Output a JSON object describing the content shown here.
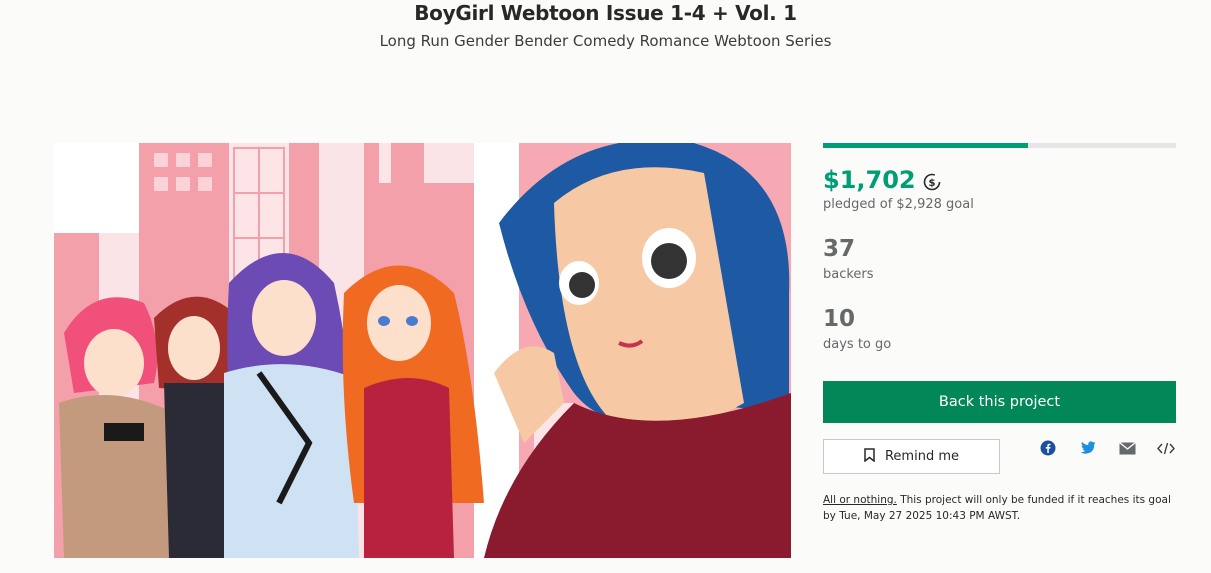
{
  "header": {
    "title": "BoyGirl Webtoon Issue 1-4 + Vol. 1",
    "subtitle": "Long Run Gender Bender Comedy Romance Webtoon Series"
  },
  "funding": {
    "progress_fraction": 0.581,
    "pledged": "$1,702",
    "pledged_sub": "pledged of $2,928 goal",
    "backers_count": "37",
    "backers_label": "backers",
    "days_count": "10",
    "days_label": "days to go"
  },
  "actions": {
    "back_label": "Back this project",
    "remind_label": "Remind me"
  },
  "share": [
    "facebook-icon",
    "twitter-icon",
    "email-icon",
    "embed-icon"
  ],
  "fine_print": {
    "link": "All or nothing.",
    "text": " This project will only be funded if it reaches its goal by Tue, May 27 2025 10:43 PM AWST."
  },
  "colors": {
    "accent": "#009e74",
    "button": "#028858",
    "facebook": "#1877f2",
    "twitter": "#1da1f2"
  }
}
